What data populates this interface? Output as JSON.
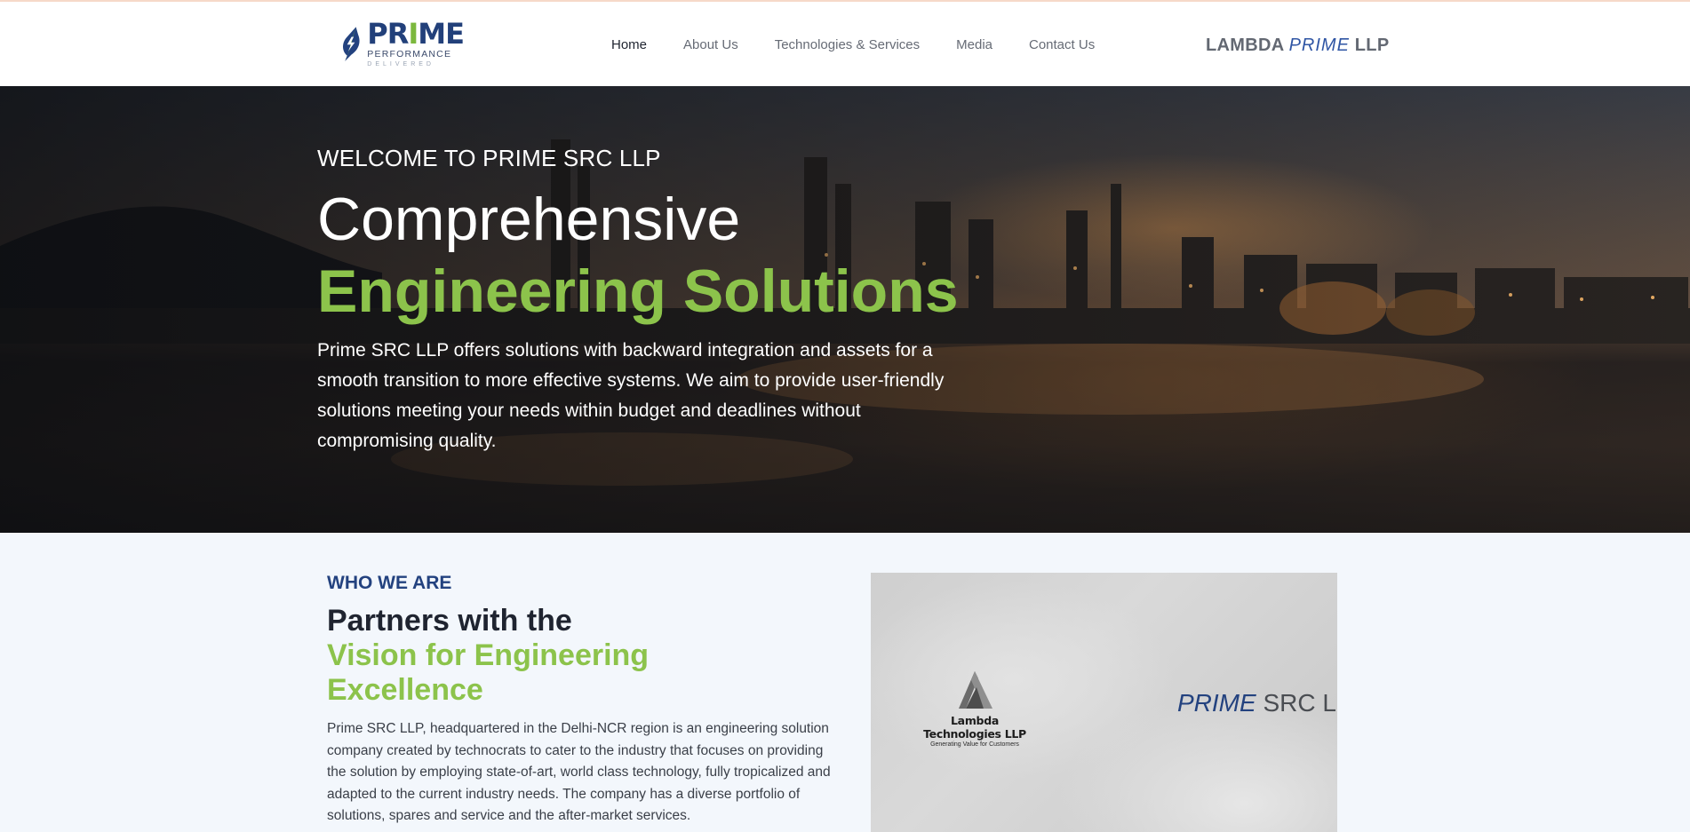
{
  "header": {
    "logo": {
      "word_left": "PR",
      "word_accent": "I",
      "word_right": "ME",
      "sub1": "PERFORMANCE",
      "sub2": "DELIVERED"
    },
    "nav": [
      {
        "label": "Home",
        "active": true
      },
      {
        "label": "About Us",
        "active": false
      },
      {
        "label": "Technologies & Services",
        "active": false
      },
      {
        "label": "Media",
        "active": false
      },
      {
        "label": "Contact Us",
        "active": false
      }
    ],
    "brand_right": {
      "lambda": "LAMBDA",
      "prime": "PRIME",
      "llp": "LLP"
    }
  },
  "hero": {
    "kicker": "WELCOME TO PRIME SRC LLP",
    "title_line1": "Comprehensive",
    "title_line2": "Engineering Solutions",
    "paragraph": "Prime SRC LLP offers solutions with backward integration and assets for a smooth transition to more effective systems. We aim to provide user-friendly solutions meeting your needs within budget and deadlines without compromising quality."
  },
  "who": {
    "kicker": "WHO WE ARE",
    "title_line1": "Partners with the",
    "title_line2": "Vision for Engineering Excellence",
    "paragraph": "Prime SRC LLP, headquartered in the Delhi-NCR region is an engineering solution company created by technocrats to cater to the industry that focuses on providing the solution by employing state-of-art, world class technology, fully tropicalized and adapted to the current industry needs. The company has a diverse portfolio of solutions, spares and service and the after-market services."
  },
  "media": {
    "lambda_name": "Lambda Technologies LLP",
    "lambda_tag": "Generating Value for Customers",
    "prime_word": "PRIME",
    "prime_rest": " SRC LLP"
  },
  "colors": {
    "brand_blue": "#23427f",
    "brand_green": "#8cc34b",
    "nav_text": "#666b75",
    "page_bg": "#f3f7fc"
  },
  "icons": {
    "logo_mark": "lightning-leaf-icon",
    "lambda_mark": "lambda-triangle-icon"
  }
}
